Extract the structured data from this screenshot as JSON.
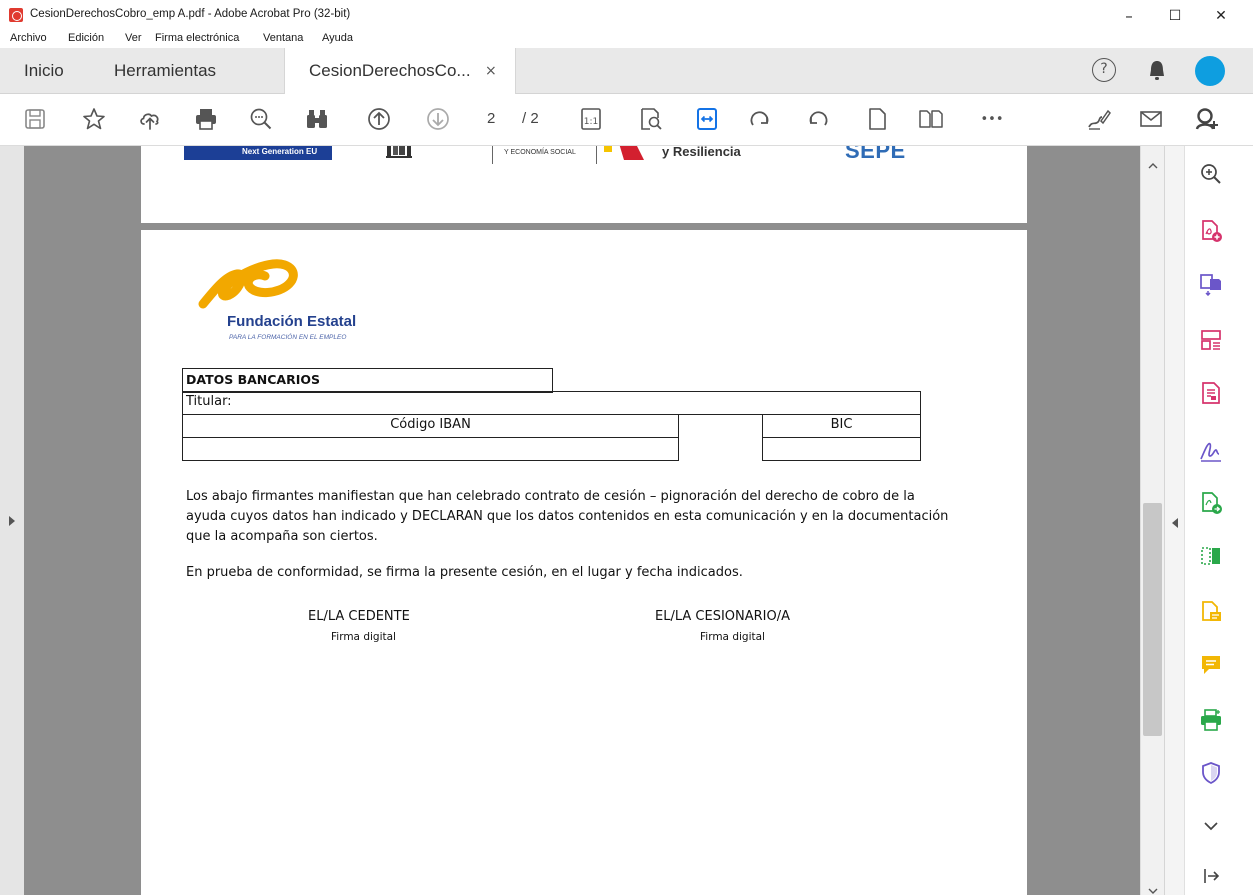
{
  "window": {
    "title": "CesionDerechosCobro_emp A.pdf - Adobe Acrobat Pro (32-bit)",
    "minimize": "–",
    "maximize": "☐",
    "close": "✕"
  },
  "menu": [
    "Archivo",
    "Edición",
    "Ver",
    "Firma electrónica",
    "Ventana",
    "Ayuda"
  ],
  "tabs": {
    "home": "Inicio",
    "tools": "Herramientas",
    "document": "CesionDerechosCo...",
    "document_close": "×",
    "help": "?"
  },
  "toolbar": {
    "current_page": "2",
    "page_total": "/ 2",
    "more": "•••"
  },
  "page1_header": {
    "next_gen": "Next Generation EU",
    "economia": "Y ECONOMÍA SOCIAL",
    "resiliencia": "y Resiliencia",
    "sepe": "SEPE"
  },
  "logo": {
    "name": "Fundación Estatal",
    "subtitle": "PARA LA FORMACIÓN EN EL EMPLEO"
  },
  "bank": {
    "heading": "DATOS BANCARIOS",
    "titular": "Titular:",
    "iban": "Código IBAN",
    "bic": "BIC"
  },
  "body": {
    "declaration": "Los abajo firmantes manifiestan que han celebrado contrato de cesión – pignoración del derecho de cobro de la ayuda cuyos datos han indicado y DECLARAN que los datos contenidos en esta comunicación y en la documentación que la acompaña son ciertos.",
    "conformity": "En prueba de conformidad, se firma la presente cesión, en el lugar y fecha indicados."
  },
  "signatures": {
    "cedente": "EL/LA CEDENTE",
    "cedente_sub": "Firma digital",
    "cesionario": "EL/LA CESIONARIO/A",
    "cesionario_sub": "Firma digital"
  },
  "colors": {
    "accent_blue": "#1473e6",
    "acrobat_red": "#e03a2f",
    "avatar": "#0e9ee0",
    "green_tool": "#2aa84a",
    "pink_tool": "#d6336c",
    "yellow_tool": "#f2b705",
    "purple_tool": "#6b56c9"
  }
}
